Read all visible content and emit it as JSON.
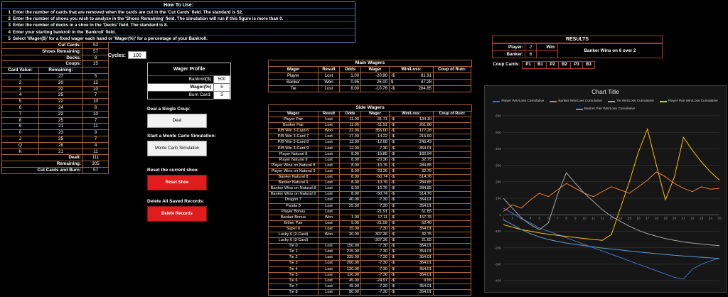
{
  "howto": {
    "title": "How To Use:",
    "steps": [
      {
        "num": "1",
        "text": "Enter the number of cards that are removed when the cards are cut in the 'Cut Cards' field. The standard is 52."
      },
      {
        "num": "2",
        "text": "Enter the number of shoes you wish to analyze in the 'Shoes Remaining' field. The simulation will run if this figure is more than 0."
      },
      {
        "num": "3",
        "text": "Enter the number of decks in a shoe in the 'Decks' field. The standard is 8."
      },
      {
        "num": "4",
        "text": "Enter your starting bankroll in the 'Bankroll' field."
      },
      {
        "num": "5",
        "text": "Select 'Wager($)' for a fixed wager each hand or 'Wager(%)' for a percentage of your Bankroll."
      }
    ]
  },
  "shoe": {
    "config": [
      {
        "label": "Cut Cards:",
        "value": "52"
      },
      {
        "label": "Shoes Remaining:",
        "value": "57"
      },
      {
        "label": "Decks:",
        "value": "8"
      },
      {
        "label": "Coups:",
        "value": "25"
      }
    ],
    "card_table": {
      "headers": [
        "Card Value:",
        "Remaining:",
        ""
      ],
      "rows": [
        [
          "1",
          "27",
          "5"
        ],
        [
          "2",
          "20",
          "12"
        ],
        [
          "3",
          "22",
          "10"
        ],
        [
          "4",
          "25",
          "7"
        ],
        [
          "5",
          "22",
          "10"
        ],
        [
          "6",
          "24",
          "8"
        ],
        [
          "7",
          "22",
          "10"
        ],
        [
          "8",
          "25",
          "7"
        ],
        [
          "9",
          "21",
          "11"
        ],
        [
          "0",
          "23",
          "9"
        ],
        [
          "J",
          "25",
          "7"
        ],
        [
          "Q",
          "28",
          "4"
        ],
        [
          "K",
          "21",
          "11"
        ]
      ]
    },
    "totals": [
      {
        "label": "Dealt:",
        "value": "111"
      },
      {
        "label": "Remaining:",
        "value": "305"
      },
      {
        "label": "Cut Cards and Burn:",
        "value": "57"
      }
    ]
  },
  "cycles": {
    "label": "Cycles:",
    "value": "100"
  },
  "wager_profile": {
    "title": "Wager Profile",
    "rows": [
      {
        "label": "Bankroll($)",
        "value": "500",
        "selected": false
      },
      {
        "label": "Wager(%)",
        "value": "5",
        "selected": true
      },
      {
        "label": "Burn Card:",
        "value": "5",
        "selected": false
      }
    ]
  },
  "actions": {
    "deal_label": "Deal a Single Coup:",
    "deal_button": "Deal",
    "mc_label": "Start a Monte Carlo Simulation:",
    "mc_button": "Monte Carlo Simulation",
    "reset_label": "Reset the current shoe:",
    "reset_button": "Reset Shoe",
    "delete_label": "Delete All Saved Records:",
    "delete_button": "Delete Records"
  },
  "main_wagers": {
    "title": "Main Wagers",
    "headers": [
      "Wager",
      "Result",
      "Odds",
      "Wager",
      "Win/Loss:",
      "Coup of Ruin:"
    ],
    "rows": [
      [
        "Player",
        "Lost",
        "1.00",
        "-20.90",
        "-$ 81.91",
        ""
      ],
      [
        "Banker",
        "Won",
        "0.95",
        "26.00",
        "$ 47.28",
        ""
      ],
      [
        "Tie",
        "Lost",
        "8.00",
        "-10.76",
        "-$ 284.85",
        ""
      ]
    ]
  },
  "side_wagers": {
    "title": "Side Wagers",
    "headers": [
      "Wager",
      "Result",
      "Odds",
      "Wager",
      "Win/Loss:",
      "Coup of Ruin:"
    ],
    "rows": [
      [
        "Player Pair",
        "Lost",
        "11.00",
        "-31.71",
        "-$ 134.10",
        ""
      ],
      [
        "Banker Pair",
        "Lost",
        "11.00",
        "-11.91",
        "-$ 261.80",
        ""
      ],
      [
        "P/B Win 3-Card 6",
        "Won",
        "22.00",
        "355.00",
        "-$ 177.28",
        ""
      ],
      [
        "P/B Win 3-Card 7",
        "Lost",
        "17.00",
        "-14.22",
        "-$ 215.69",
        ""
      ],
      [
        "P/B Win 3-Card 8",
        "Lost",
        "13.00",
        "-12.68",
        "-$ 246.43",
        ""
      ],
      [
        "P/B Win 3-Card 9",
        "Lost",
        "12.00",
        "-7.30",
        "-$ 354.01",
        ""
      ],
      [
        "Player Natural 8",
        "Lost",
        "8.00",
        "-15.85",
        "-$ 182.94",
        ""
      ],
      [
        "Player Natural 9",
        "Lost",
        "8.00",
        "-23.36",
        "-$ 32.75",
        ""
      ],
      [
        "Player Wins on Natural 8",
        "Lost",
        "8.00",
        "-10.76",
        "-$ 284.85",
        ""
      ],
      [
        "Player Wins on Natural 9",
        "Lost",
        "8.00",
        "-23.36",
        "-$ 32.75",
        ""
      ],
      [
        "Banker Natural 8",
        "Lost",
        "8.00",
        "-50.74",
        "-$ 514.76",
        ""
      ],
      [
        "Banker Natural 9",
        "Lost",
        "8.00",
        "-10.76",
        "-$ 284.85",
        ""
      ],
      [
        "Banker Wins on Natural 8",
        "Lost",
        "8.00",
        "-10.76",
        "-$ 284.85",
        ""
      ],
      [
        "Banker Wins on Natural 9",
        "Lost",
        "8.00",
        "-50.74",
        "-$ 514.76",
        ""
      ],
      [
        "Dragon 7",
        "Lost",
        "40.00",
        "-7.30",
        "-$ 354.01",
        ""
      ],
      [
        "Panda 8",
        "Lost",
        "25.00",
        "-7.30",
        "-$ 354.01",
        ""
      ],
      [
        "Player Bonus",
        "Lost",
        "",
        "-21.91",
        "-$ 61.85",
        ""
      ],
      [
        "Banker Bonus",
        "Won",
        "1.00",
        "17.11",
        "-$ 157.75",
        ""
      ],
      [
        "Either Pair",
        "Lost",
        "5.00",
        "-21.08",
        "-$ 62.40",
        ""
      ],
      [
        "Super 6",
        "Lost",
        "15.00",
        "-7.30",
        "-$ 354.01",
        ""
      ],
      [
        "Lucky 6 (2-Card)",
        "Won",
        "20.00",
        "307.36",
        "-$ 32.75",
        ""
      ],
      [
        "Lucky 6 (3-Card)",
        "",
        "",
        "-307.36",
        "-$ 21.65",
        ""
      ],
      [
        "Tie 0",
        "Lost",
        "150.00",
        "-7.30",
        "-$ 354.01",
        ""
      ],
      [
        "Tie 1",
        "Lost",
        "215.00",
        "-7.30",
        "-$ 354.01",
        ""
      ],
      [
        "Tie 2",
        "Lost",
        "225.00",
        "-7.30",
        "-$ 354.01",
        ""
      ],
      [
        "Tie 3",
        "Lost",
        "200.00",
        "-7.30",
        "-$ 354.01",
        ""
      ],
      [
        "Tie 4",
        "Lost",
        "120.00",
        "-7.30",
        "-$ 354.01",
        ""
      ],
      [
        "Tie 5",
        "Lost",
        "110.00",
        "-7.30",
        "-$ 354.01",
        ""
      ],
      [
        "Tie 6",
        "Lost",
        "45.00",
        "-24.97",
        "-$ 0.55",
        ""
      ],
      [
        "Tie 7",
        "Lost",
        "45.00",
        "-7.30",
        "-$ 354.01",
        ""
      ],
      [
        "Tie 8",
        "Lost",
        "80.00",
        "-7.30",
        "-$ 354.01",
        ""
      ]
    ]
  },
  "results": {
    "title": "RESULTS",
    "player_label": "Player:",
    "player_value": "2",
    "win_label": "Win:",
    "message": "Banker Wins on 6 over 2",
    "banker_label": "Banker:",
    "banker_value": "6",
    "coup_label": "Coup Cards:",
    "coup_cols": [
      "P1",
      "B1",
      "P2",
      "B2",
      "P3",
      "B3"
    ]
  },
  "chart_data": {
    "type": "line",
    "title": "Chart Title",
    "x": [
      1,
      2,
      3,
      4,
      5,
      6,
      7,
      8,
      9,
      10,
      11,
      12,
      13,
      14,
      15,
      16,
      17,
      18,
      19,
      20,
      21,
      22,
      23,
      24,
      25
    ],
    "ylim": [
      -400,
      600
    ],
    "ytick_step": 100,
    "grid": true,
    "legend_position": "top",
    "series": [
      {
        "name": "Player Win/Loss Cumulative",
        "color": "#4472c4",
        "values": [
          40,
          10,
          -25,
          -50,
          -80,
          -100,
          -120,
          -140,
          -160,
          -180,
          -200,
          -220,
          -240,
          -260,
          -280,
          -300,
          -320,
          -340,
          -360,
          -380,
          -390,
          -330,
          -300,
          -280,
          -265
        ]
      },
      {
        "name": "Banker Win/Loss Cumulative",
        "color": "#ed7d31",
        "values": [
          20,
          60,
          40,
          90,
          130,
          110,
          150,
          190,
          160,
          130,
          110,
          140,
          170,
          150,
          130,
          170,
          210,
          260,
          230,
          190,
          160,
          140,
          170,
          155,
          160
        ]
      },
      {
        "name": "Tie Win/Loss Cumulative",
        "color": "#a5a5a5",
        "values": [
          100,
          40,
          -20,
          -60,
          -90,
          -50,
          120,
          255,
          190,
          130,
          80,
          30,
          -10,
          -40,
          -70,
          -95,
          -115,
          -130,
          -145,
          -155,
          -165,
          -172,
          -178,
          -183,
          -188
        ]
      },
      {
        "name": "Player Pair Win/Loss Cumulative",
        "color": "#ffc000",
        "values": [
          -60,
          -75,
          -90,
          -100,
          -110,
          -118,
          -125,
          -132,
          -138,
          -144,
          -150,
          -155,
          -120,
          40,
          200,
          380,
          520,
          300,
          90,
          230,
          470,
          390,
          320,
          260,
          210
        ]
      },
      {
        "name": "Banker Pair Win/Loss Cumulative",
        "color": "#5b9bd5",
        "values": [
          -30,
          -60,
          -90,
          -115,
          -135,
          -150,
          -162,
          -172,
          -180,
          -188,
          -195,
          -202,
          -208,
          -214,
          -220,
          -226,
          -231,
          -236,
          -241,
          -246,
          -250,
          -254,
          -258,
          -262,
          -266
        ]
      }
    ]
  }
}
